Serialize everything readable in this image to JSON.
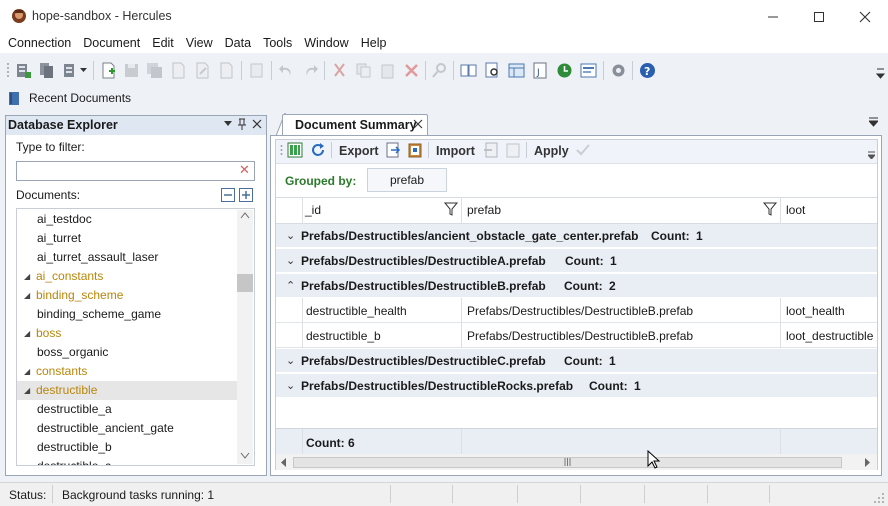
{
  "window": {
    "title": "hope-sandbox - Hercules",
    "controls": [
      "minimize-icon",
      "maximize-icon",
      "close-icon"
    ]
  },
  "menu": [
    "Connection",
    "Document",
    "Edit",
    "View",
    "Data",
    "Tools",
    "Window",
    "Help"
  ],
  "recent_documents": {
    "label": "Recent Documents"
  },
  "explorer": {
    "title": "Database Explorer",
    "filter_label": "Type to filter:",
    "filter_value": "",
    "documents_label": "Documents:",
    "tree": [
      {
        "label": "ai_testdoc",
        "type": "leaf"
      },
      {
        "label": "ai_turret",
        "type": "leaf"
      },
      {
        "label": "ai_turret_assault_laser",
        "type": "leaf"
      },
      {
        "label": "ai_constants",
        "type": "folder"
      },
      {
        "label": "binding_scheme",
        "type": "folder"
      },
      {
        "label": "binding_scheme_game",
        "type": "leaf"
      },
      {
        "label": "boss",
        "type": "folder"
      },
      {
        "label": "boss_organic",
        "type": "leaf"
      },
      {
        "label": "constants",
        "type": "folder"
      },
      {
        "label": "destructible",
        "type": "folder",
        "selected": true
      },
      {
        "label": "destructible_a",
        "type": "leaf"
      },
      {
        "label": "destructible_ancient_gate",
        "type": "leaf"
      },
      {
        "label": "destructible_b",
        "type": "leaf"
      },
      {
        "label": "destructible_c",
        "type": "leaf"
      }
    ]
  },
  "summary": {
    "tab_label": "Document Summary",
    "toolbar": {
      "export": "Export",
      "import": "Import",
      "apply": "Apply"
    },
    "grouped_by_label": "Grouped by:",
    "grouped_by_value": "prefab",
    "columns": [
      "_id",
      "prefab",
      "loot"
    ],
    "groups": [
      {
        "name": "Prefabs/Destructibles/ancient_obstacle_gate_center.prefab",
        "count_label": "Count:",
        "count": "1",
        "expanded": false
      },
      {
        "name": "Prefabs/Destructibles/DestructibleA.prefab",
        "count_label": "Count:",
        "count": "1",
        "expanded": false
      },
      {
        "name": "Prefabs/Destructibles/DestructibleB.prefab",
        "count_label": "Count:",
        "count": "2",
        "expanded": true,
        "rows": [
          {
            "_id": "destructible_health",
            "prefab": "Prefabs/Destructibles/DestructibleB.prefab",
            "loot": "loot_health"
          },
          {
            "_id": "destructible_b",
            "prefab": "Prefabs/Destructibles/DestructibleB.prefab",
            "loot": "loot_destructible"
          }
        ]
      },
      {
        "name": "Prefabs/Destructibles/DestructibleC.prefab",
        "count_label": "Count:",
        "count": "1",
        "expanded": false
      },
      {
        "name": "Prefabs/Destructibles/DestructibleRocks.prefab",
        "count_label": "Count:",
        "count": "1",
        "expanded": false
      }
    ],
    "total": "Count: 6"
  },
  "status": {
    "label": "Status:",
    "text": "Background tasks running: 1"
  },
  "colors": {
    "folder": "#b8860b",
    "grouped_by": "#2c7a2c",
    "group_row_bg": "#e9eef5"
  }
}
